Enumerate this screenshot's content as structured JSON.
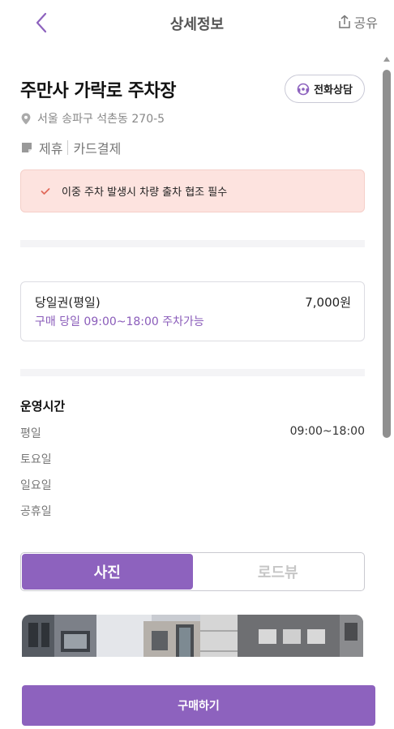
{
  "header": {
    "title": "상세정보",
    "share_label": "공유"
  },
  "lot": {
    "name": "주만사 가락로 주차장",
    "call_label": "전화상담",
    "address": "서울 송파구 석촌동 270-5",
    "tags": [
      "제휴",
      "카드결제"
    ]
  },
  "notice": {
    "text": "이중 주차 발생시 차량 출차 협조 필수"
  },
  "ticket": {
    "name": "당일권(평일)",
    "price": "7,000원",
    "note": "구매 당일 09:00~18:00 주차가능"
  },
  "hours": {
    "title": "운영시간",
    "rows": [
      {
        "day": "평일",
        "time": "09:00~18:00"
      },
      {
        "day": "토요일",
        "time": ""
      },
      {
        "day": "일요일",
        "time": ""
      },
      {
        "day": "공휴일",
        "time": ""
      }
    ]
  },
  "tabs": [
    {
      "label": "사진",
      "active": true
    },
    {
      "label": "로드뷰",
      "active": false
    }
  ],
  "footer": {
    "buy_label": "구매하기"
  },
  "colors": {
    "accent": "#8d62be",
    "notice_bg": "#fde3df",
    "notice_check": "#e06a5a"
  },
  "icons": {
    "back": "chevron-left-icon",
    "share": "share-icon",
    "call": "headset-icon",
    "address": "map-pin-icon",
    "tag": "sticky-note-icon",
    "notice": "check-icon"
  }
}
